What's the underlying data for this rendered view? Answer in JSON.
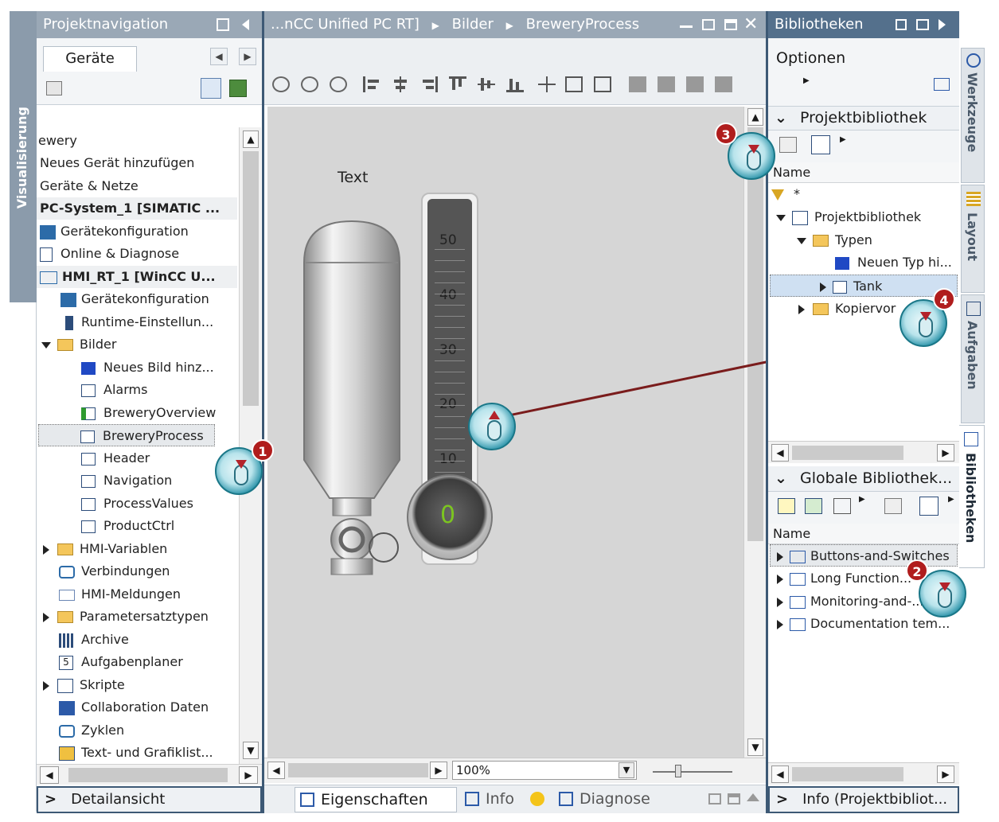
{
  "colors": {
    "accent": "#54708c",
    "title_gray": "#9aa8b6",
    "canvas": "#d6d6d6",
    "selection": "#cfe0f2",
    "marker_red": "#b01d1d",
    "green_value": "#7cc520"
  },
  "left_panel": {
    "title": "Projektnavigation",
    "tab": "Geräte",
    "vertical_tab": "Visualisierung",
    "items": [
      {
        "label": "ewery"
      },
      {
        "label": "Neues Gerät hinzufügen"
      },
      {
        "label": "Geräte & Netze"
      },
      {
        "label": "PC-System_1 [SIMATIC ..."
      },
      {
        "label": "Gerätekonfiguration"
      },
      {
        "label": "Online & Diagnose"
      },
      {
        "label": "HMI_RT_1 [WinCC U..."
      },
      {
        "label": "Gerätekonfiguration"
      },
      {
        "label": "Runtime-Einstellun..."
      },
      {
        "label": "Bilder"
      },
      {
        "label": "Neues Bild hinz..."
      },
      {
        "label": "Alarms"
      },
      {
        "label": "BreweryOverview"
      },
      {
        "label": "BreweryProcess"
      },
      {
        "label": "Header"
      },
      {
        "label": "Navigation"
      },
      {
        "label": "ProcessValues"
      },
      {
        "label": "ProductCtrl"
      },
      {
        "label": "HMI-Variablen"
      },
      {
        "label": "Verbindungen"
      },
      {
        "label": "HMI-Meldungen"
      },
      {
        "label": "Parametersatztypen"
      },
      {
        "label": "Archive"
      },
      {
        "label": "Aufgabenplaner"
      },
      {
        "label": "Skripte"
      },
      {
        "label": "Collaboration Daten"
      },
      {
        "label": "Zyklen"
      },
      {
        "label": "Text- und Grafiklist..."
      }
    ],
    "detail": "Detailansicht"
  },
  "editor": {
    "breadcrumb": [
      "...nCC Unified PC RT]",
      "Bilder",
      "BreweryProcess"
    ],
    "text_label": "Text",
    "gauge_ticks": [
      "50",
      "40",
      "30",
      "20",
      "10"
    ],
    "gauge_value": "0",
    "zoom": "100%",
    "bottom_tabs": [
      "Eigenschaften",
      "Info",
      "Diagnose"
    ]
  },
  "right_panel": {
    "title": "Bibliotheken",
    "options": "Optionen",
    "project_lib": "Projektbibliothek",
    "name_header": "Name",
    "filter": "*",
    "proj_tree": [
      "Projektbibliothek",
      "Typen",
      "Neuen Typ hi...",
      "Tank",
      "Kopiervor"
    ],
    "global_lib": "Globale Bibliothek...",
    "global_tree": [
      "Buttons-and-Switches",
      "Long Function...",
      "Monitoring-and-...",
      "Documentation tem..."
    ],
    "info": "Info (Projektbibliot..."
  },
  "side_tabs": [
    "Werkzeuge",
    "Layout",
    "Aufgaben",
    "Bibliotheken"
  ],
  "markers": [
    "1",
    "2",
    "3",
    "4"
  ]
}
